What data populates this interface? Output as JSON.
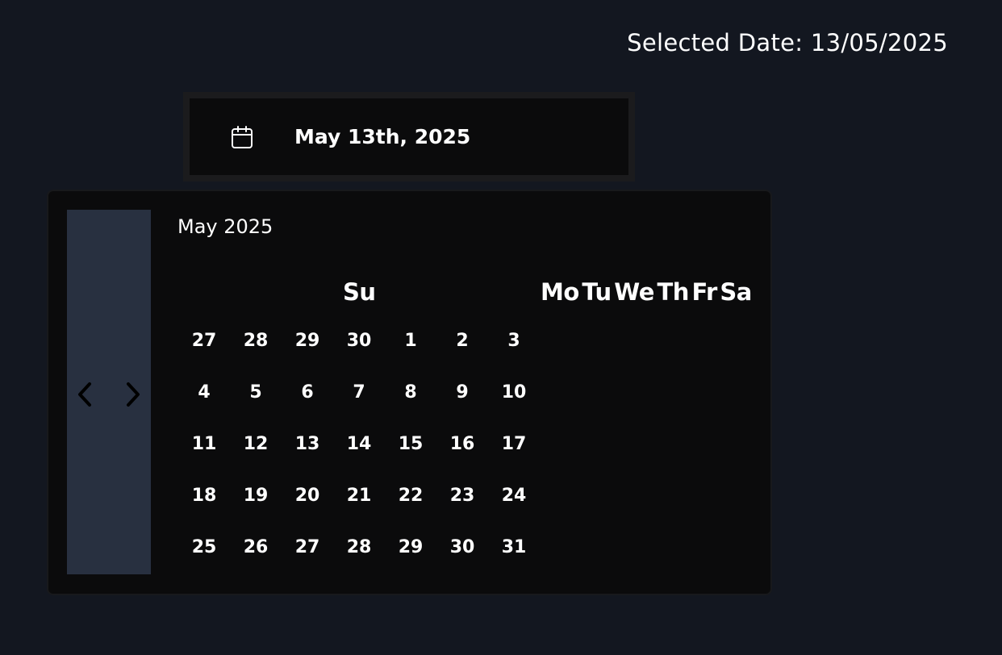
{
  "selected_date_label": "Selected Date: 13/05/2025",
  "trigger": {
    "icon": "calendar-icon",
    "value": "May 13th, 2025"
  },
  "calendar": {
    "caption": "May 2025",
    "nav": {
      "prev_icon": "chevron-left-icon",
      "next_icon": "chevron-right-icon"
    },
    "weekdays": [
      "Su",
      "Mo",
      "Tu",
      "We",
      "Th",
      "Fr",
      "Sa"
    ],
    "weeks": [
      [
        "27",
        "28",
        "29",
        "30",
        "1",
        "2",
        "3"
      ],
      [
        "4",
        "5",
        "6",
        "7",
        "8",
        "9",
        "10"
      ],
      [
        "11",
        "12",
        "13",
        "14",
        "15",
        "16",
        "17"
      ],
      [
        "18",
        "19",
        "20",
        "21",
        "22",
        "23",
        "24"
      ],
      [
        "25",
        "26",
        "27",
        "28",
        "29",
        "30",
        "31"
      ]
    ]
  },
  "colors": {
    "background": "#131720",
    "popover": "#0b0b0c",
    "nav_panel": "#283040",
    "text": "#ffffff"
  }
}
